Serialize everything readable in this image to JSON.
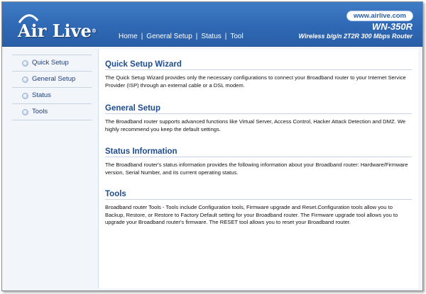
{
  "brand": {
    "logo_text": "Air Live",
    "logo_mark": "®",
    "url": "www.airlive.com",
    "model": "WN-350R",
    "subtitle": "Wireless b/g/n 2T2R 300 Mbps Router"
  },
  "nav": {
    "items": [
      "Home",
      "General Setup",
      "Status",
      "Tool"
    ],
    "separator": "|"
  },
  "sidebar": {
    "items": [
      {
        "label": "Quick Setup"
      },
      {
        "label": "General Setup"
      },
      {
        "label": "Status"
      },
      {
        "label": "Tools"
      }
    ]
  },
  "sections": [
    {
      "title": "Quick Setup Wizard",
      "body": "The Quick Setup Wizard provides only the necessary configurations to connect your Broadband router to your Internet Service Provider (ISP) through an external cable or a DSL modem."
    },
    {
      "title": "General Setup",
      "body": "The Broadband router supports advanced functions like Virtual Server, Access Control, Hacker Attack Detection and DMZ. We highly recommend you keep the default settings."
    },
    {
      "title": "Status Information",
      "body": "The Broadband router's status information provides the following information about your Broadband router: Hardware/Firmware version, Serial Number, and its current operating status."
    },
    {
      "title": "Tools",
      "body": "Broadband router Tools - Tools include Configuration tools, Firmware upgrade and Reset.Configuration tools allow you to Backup, Restore, or Restore to Factory Default setting for your Broadband router. The Firmware upgrade tool allows you to upgrade your Broadband router's firmware. The RESET tool allows you to reset your Broadband router."
    }
  ],
  "colors": {
    "header": "#2f68b4",
    "section_title": "#1d4c8f",
    "sidebar_text": "#1f3f7a"
  }
}
